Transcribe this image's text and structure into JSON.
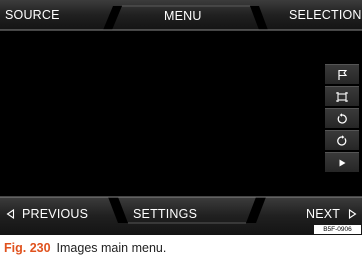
{
  "top_bar": {
    "source_label": "SOURCE",
    "menu_label": "MENU",
    "selection_label": "SELECTION"
  },
  "bottom_bar": {
    "previous_label": "PREVIOUS",
    "settings_label": "SETTINGS",
    "next_label": "NEXT"
  },
  "side_buttons": [
    {
      "icon": "flag-icon"
    },
    {
      "icon": "fit-to-screen-icon"
    },
    {
      "icon": "rotate-counterclockwise-icon"
    },
    {
      "icon": "rotate-clockwise-icon"
    },
    {
      "icon": "play-icon"
    }
  ],
  "image_code": "B5F-0906",
  "caption": {
    "figure_label": "Fig. 230",
    "text": "Images main menu."
  },
  "colors": {
    "accent": "#e0521e",
    "bar_background": "#1e1e1e",
    "bar_highlight": "#7a7a7a",
    "screen": "#000000"
  }
}
